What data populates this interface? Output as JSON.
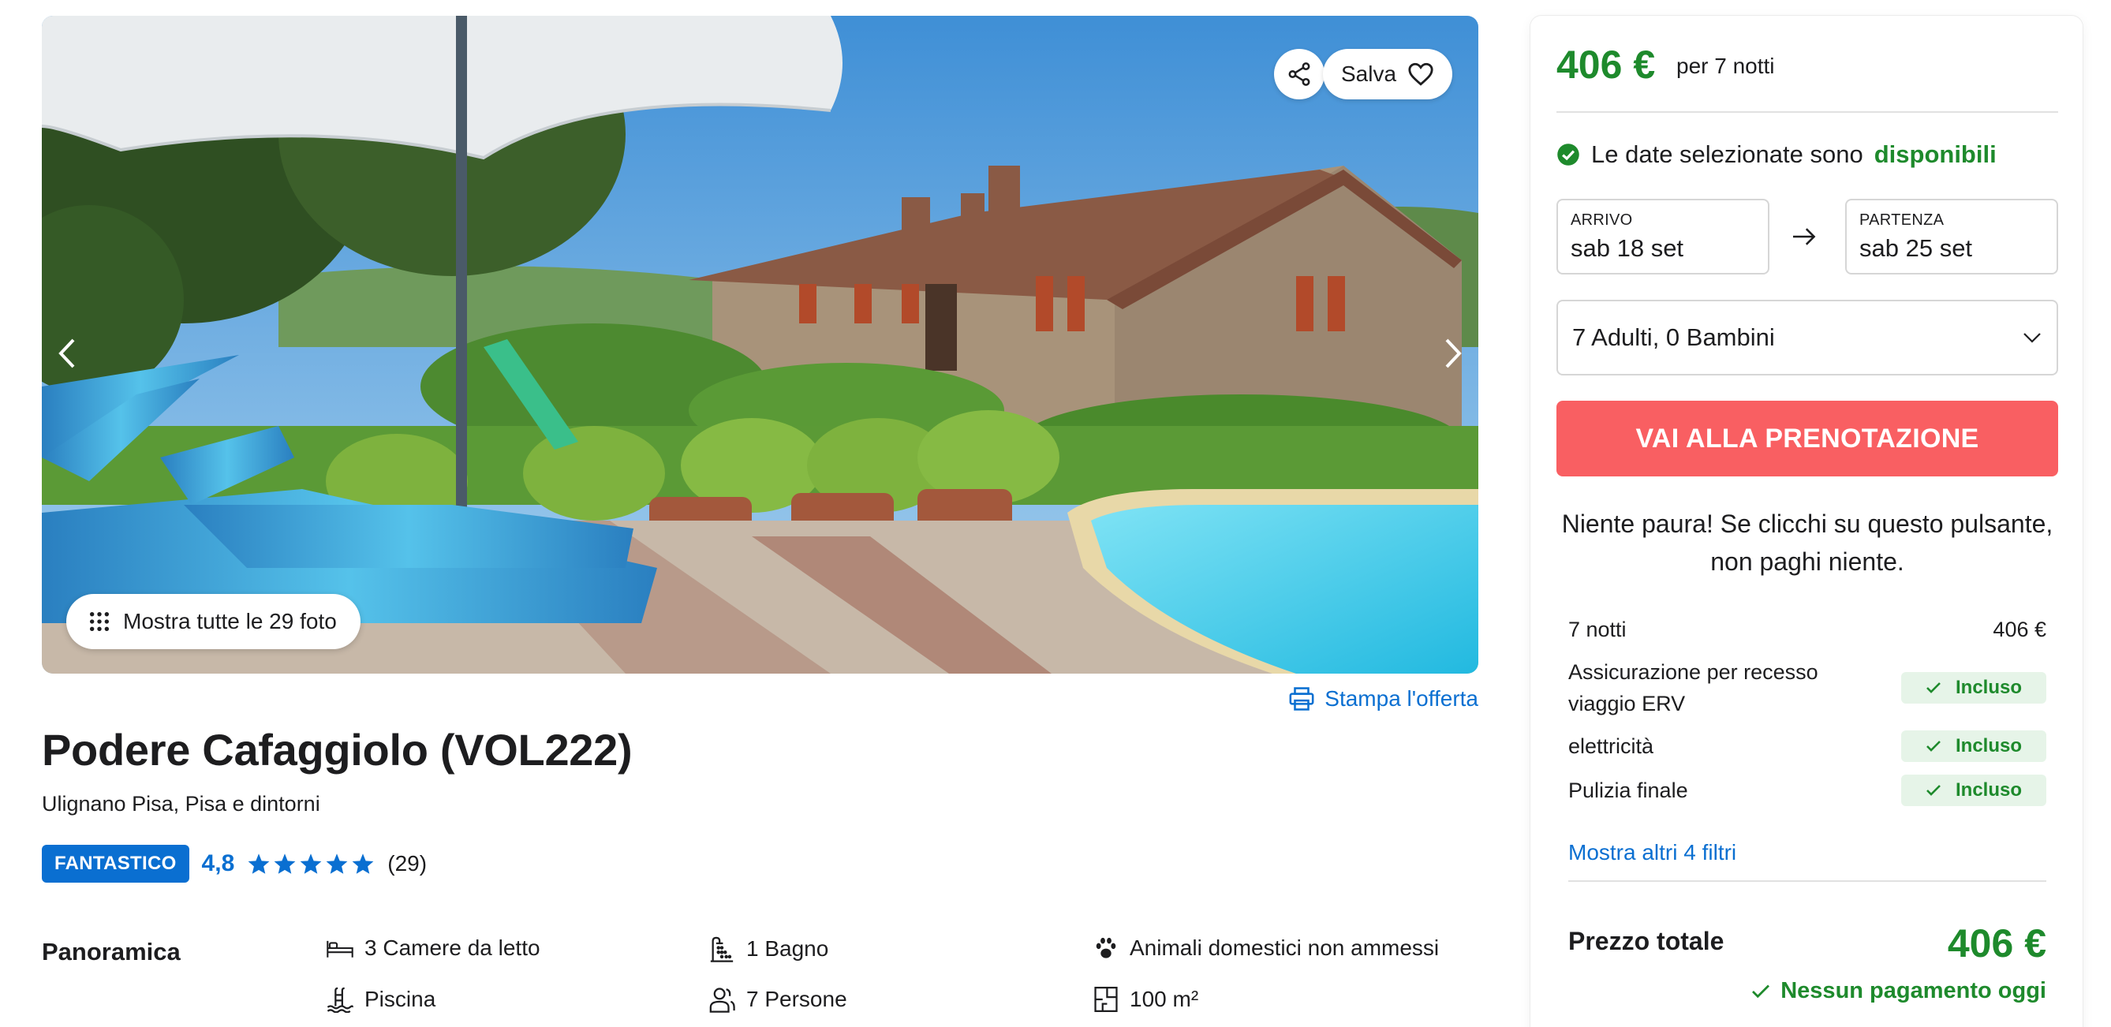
{
  "gallery": {
    "save_label": "Salva",
    "all_photos_label": "Mostra tutte le 29 foto"
  },
  "print_label": "Stampa l'offerta",
  "listing": {
    "title": "Podere Cafaggiolo (VOL222)",
    "location": "Ulignano Pisa, Pisa e dintorni",
    "rating_badge": "FANTASTICO",
    "rating_score": "4,8",
    "rating_stars": 5,
    "rating_count": "(29)"
  },
  "overview": {
    "heading": "Panoramica",
    "features": [
      {
        "icon": "bed-icon",
        "label": "3 Camere da letto"
      },
      {
        "icon": "shower-icon",
        "label": "1 Bagno"
      },
      {
        "icon": "paw-icon",
        "label": "Animali domestici non ammessi"
      },
      {
        "icon": "pool-icon",
        "label": "Piscina"
      },
      {
        "icon": "people-icon",
        "label": "7 Persone"
      },
      {
        "icon": "floorplan-icon",
        "label": "100 m²"
      }
    ]
  },
  "booking": {
    "price": "406 €",
    "price_note": "per 7 notti",
    "availability_text": "Le date selezionate sono",
    "availability_status": "disponibili",
    "arrival_label": "ARRIVO",
    "arrival_value": "sab 18 set",
    "departure_label": "PARTENZA",
    "departure_value": "sab 25 set",
    "guests": "7 Adulti, 0 Bambini",
    "book_button": "VAI ALLA PRENOTAZIONE",
    "reassure_line1": "Niente paura! Se clicchi su questo pulsante,",
    "reassure_line2": "non paghi niente.",
    "line_items": [
      {
        "label": "7 notti",
        "value": "406 €"
      },
      {
        "label": "Assicurazione per recesso viaggio ERV",
        "value": "Incluso"
      },
      {
        "label": "elettricità",
        "value": "Incluso"
      },
      {
        "label": "Pulizia finale",
        "value": "Incluso"
      }
    ],
    "more_filters": "Mostra altri 4 filtri",
    "total_label": "Prezzo totale",
    "total_price": "406 €",
    "no_payment": "Nessun pagamento oggi"
  },
  "colors": {
    "accent_blue": "#0a6fd1",
    "price_green": "#1e8a2c",
    "cta_red": "#f95f62"
  }
}
